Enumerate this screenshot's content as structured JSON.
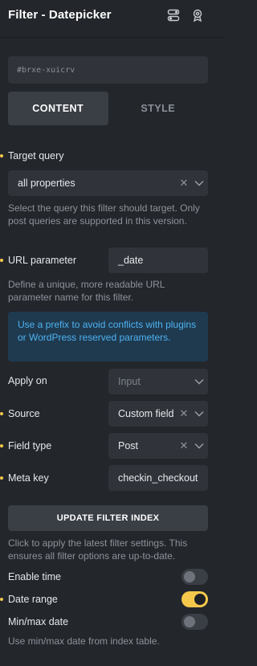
{
  "header": {
    "title": "Filter - Datepicker",
    "icons": [
      "layout-toggle-icon",
      "badge-icon"
    ]
  },
  "element_id": "#brxe-xuicrv",
  "tabs": [
    {
      "label": "CONTENT",
      "active": true
    },
    {
      "label": "STYLE",
      "active": false
    }
  ],
  "target_query": {
    "label": "Target query",
    "value": "all properties",
    "description": "Select the query this filter should target. Only post queries are supported in this version."
  },
  "url_parameter": {
    "label": "URL parameter",
    "value": "_date",
    "description": "Define a unique, more readable URL parameter name for this filter."
  },
  "notice": "Use a prefix to avoid conflicts with plugins or WordPress reserved parameters.",
  "apply_on": {
    "label": "Apply on",
    "placeholder": "Input"
  },
  "source": {
    "label": "Source",
    "value": "Custom field"
  },
  "field_type": {
    "label": "Field type",
    "value": "Post"
  },
  "meta_key": {
    "label": "Meta key",
    "value": "checkin_checkout"
  },
  "update_button": {
    "label": "UPDATE FILTER INDEX",
    "description": "Click to apply the latest filter settings. This ensures all filter options are up-to-date."
  },
  "enable_time": {
    "label": "Enable time",
    "enabled": false
  },
  "date_range": {
    "label": "Date range",
    "enabled": true
  },
  "min_max_date": {
    "label": "Min/max date",
    "enabled": false,
    "description": "Use min/max date from index table."
  },
  "colors": {
    "background": "#23262b",
    "field": "#30343a",
    "accent": "#f5c84c",
    "notice_bg": "#1f3a4f",
    "notice_text": "#4eb2f2"
  }
}
